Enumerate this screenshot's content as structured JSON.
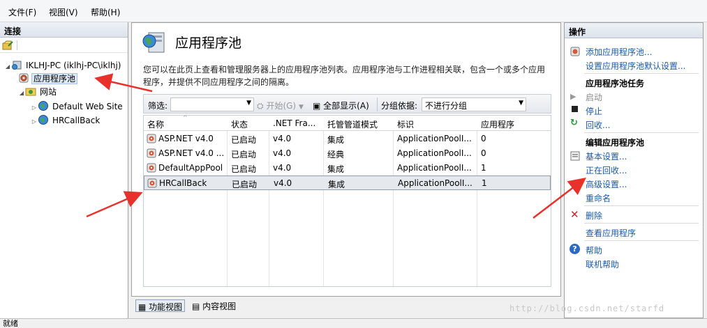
{
  "menu": [
    "文件(F)",
    "视图(V)",
    "帮助(H)"
  ],
  "left_pane": {
    "header": "连接",
    "tree": {
      "server": "IKLHJ-PC (iklhj-PC\\iklhj)",
      "app_pools": "应用程序池",
      "sites": "网站",
      "site1": "Default Web Site",
      "site2": "HRCallBack"
    }
  },
  "center": {
    "title": "应用程序池",
    "description": "您可以在此页上查看和管理服务器上的应用程序池列表。应用程序池与工作进程相关联，包含一个或多个应用程序，并提供不同应用程序之间的隔离。",
    "filter": {
      "label": "筛选:",
      "start": "开始(G)",
      "show_all": "全部显示(A)",
      "group_by": "分组依据:",
      "group_value": "不进行分组"
    },
    "columns": [
      "名称",
      "状态",
      ".NET Fra...",
      "托管管道模式",
      "标识",
      "应用程序"
    ],
    "rows": [
      {
        "name": "ASP.NET v4.0",
        "status": "已启动",
        "net": "v4.0",
        "mode": "集成",
        "identity": "ApplicationPoolI...",
        "apps": "0"
      },
      {
        "name": "ASP.NET v4.0 ...",
        "status": "已启动",
        "net": "v4.0",
        "mode": "经典",
        "identity": "ApplicationPoolI...",
        "apps": "0"
      },
      {
        "name": "DefaultAppPool",
        "status": "已启动",
        "net": "v4.0",
        "mode": "集成",
        "identity": "ApplicationPoolI...",
        "apps": "1"
      },
      {
        "name": "HRCallBack",
        "status": "已启动",
        "net": "v4.0",
        "mode": "集成",
        "identity": "ApplicationPoolI...",
        "apps": "1"
      }
    ],
    "views": {
      "features": "功能视图",
      "content": "内容视图"
    }
  },
  "actions": {
    "header": "操作",
    "add_pool": "添加应用程序池...",
    "set_defaults": "设置应用程序池默认设置...",
    "tasks_title": "应用程序池任务",
    "start": "启动",
    "stop": "停止",
    "recycle": "回收...",
    "edit_title": "编辑应用程序池",
    "basic_settings": "基本设置...",
    "recycling": "正在回收...",
    "advanced_settings": "高级设置...",
    "rename": "重命名",
    "delete": "删除",
    "view_apps": "查看应用程序",
    "help": "帮助",
    "online_help": "联机帮助"
  },
  "status": "就绪",
  "watermark": "http://blog.csdn.net/starfd",
  "colors": {
    "link": "#1c5aa6",
    "arrow": "#e8312a",
    "selection": "#dde8f5"
  }
}
